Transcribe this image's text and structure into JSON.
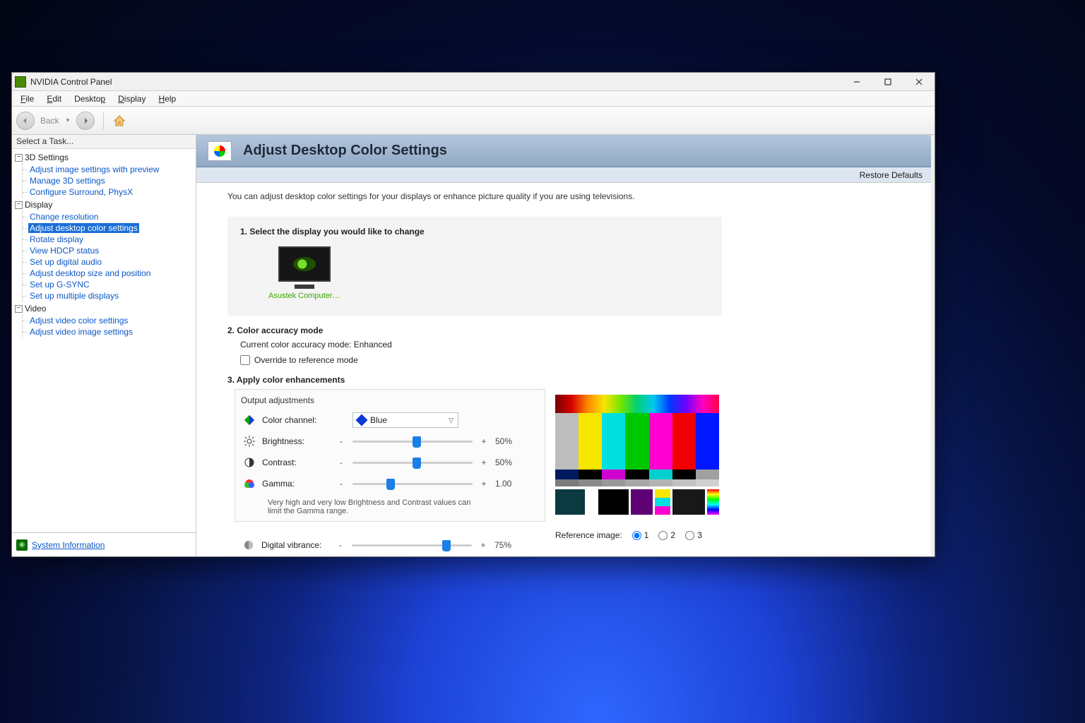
{
  "window": {
    "title": "NVIDIA Control Panel"
  },
  "menubar": {
    "file": "File",
    "edit": "Edit",
    "desktop": "Desktop",
    "display": "Display",
    "help": "Help"
  },
  "toolbar": {
    "back": "Back"
  },
  "sidebar": {
    "selectTask": "Select a Task...",
    "cat3d": "3D Settings",
    "items3d": [
      "Adjust image settings with preview",
      "Manage 3D settings",
      "Configure Surround, PhysX"
    ],
    "catDisplay": "Display",
    "itemsDisplay": [
      "Change resolution",
      "Adjust desktop color settings",
      "Rotate display",
      "View HDCP status",
      "Set up digital audio",
      "Adjust desktop size and position",
      "Set up G-SYNC",
      "Set up multiple displays"
    ],
    "catVideo": "Video",
    "itemsVideo": [
      "Adjust video color settings",
      "Adjust video image settings"
    ],
    "systemInfo": "System Information"
  },
  "main": {
    "title": "Adjust Desktop Color Settings",
    "restoreDefaults": "Restore Defaults",
    "description": "You can adjust desktop color settings for your displays or enhance picture quality if you are using televisions.",
    "step1": "1. Select the display you would like to change",
    "displayLabel": "Asustek Computer…",
    "step2": "2. Color accuracy mode",
    "currentMode": "Current color accuracy mode: Enhanced",
    "overrideLabel": "Override to reference mode",
    "step3": "3. Apply color enhancements",
    "outputAdj": "Output adjustments",
    "colorChannelLabel": "Color channel:",
    "colorChannelValue": "Blue",
    "brightnessLabel": "Brightness:",
    "brightnessValue": "50%",
    "contrastLabel": "Contrast:",
    "contrastValue": "50%",
    "gammaLabel": "Gamma:",
    "gammaValue": "1.00",
    "gammaNote": "Very high and very low Brightness and Contrast values can limit the Gamma range.",
    "digitalVibranceLabel": "Digital vibrance:",
    "digitalVibranceValue": "75%",
    "minus": "-",
    "plus": "+",
    "referenceImage": "Reference image:",
    "ref1": "1",
    "ref2": "2",
    "ref3": "3"
  }
}
